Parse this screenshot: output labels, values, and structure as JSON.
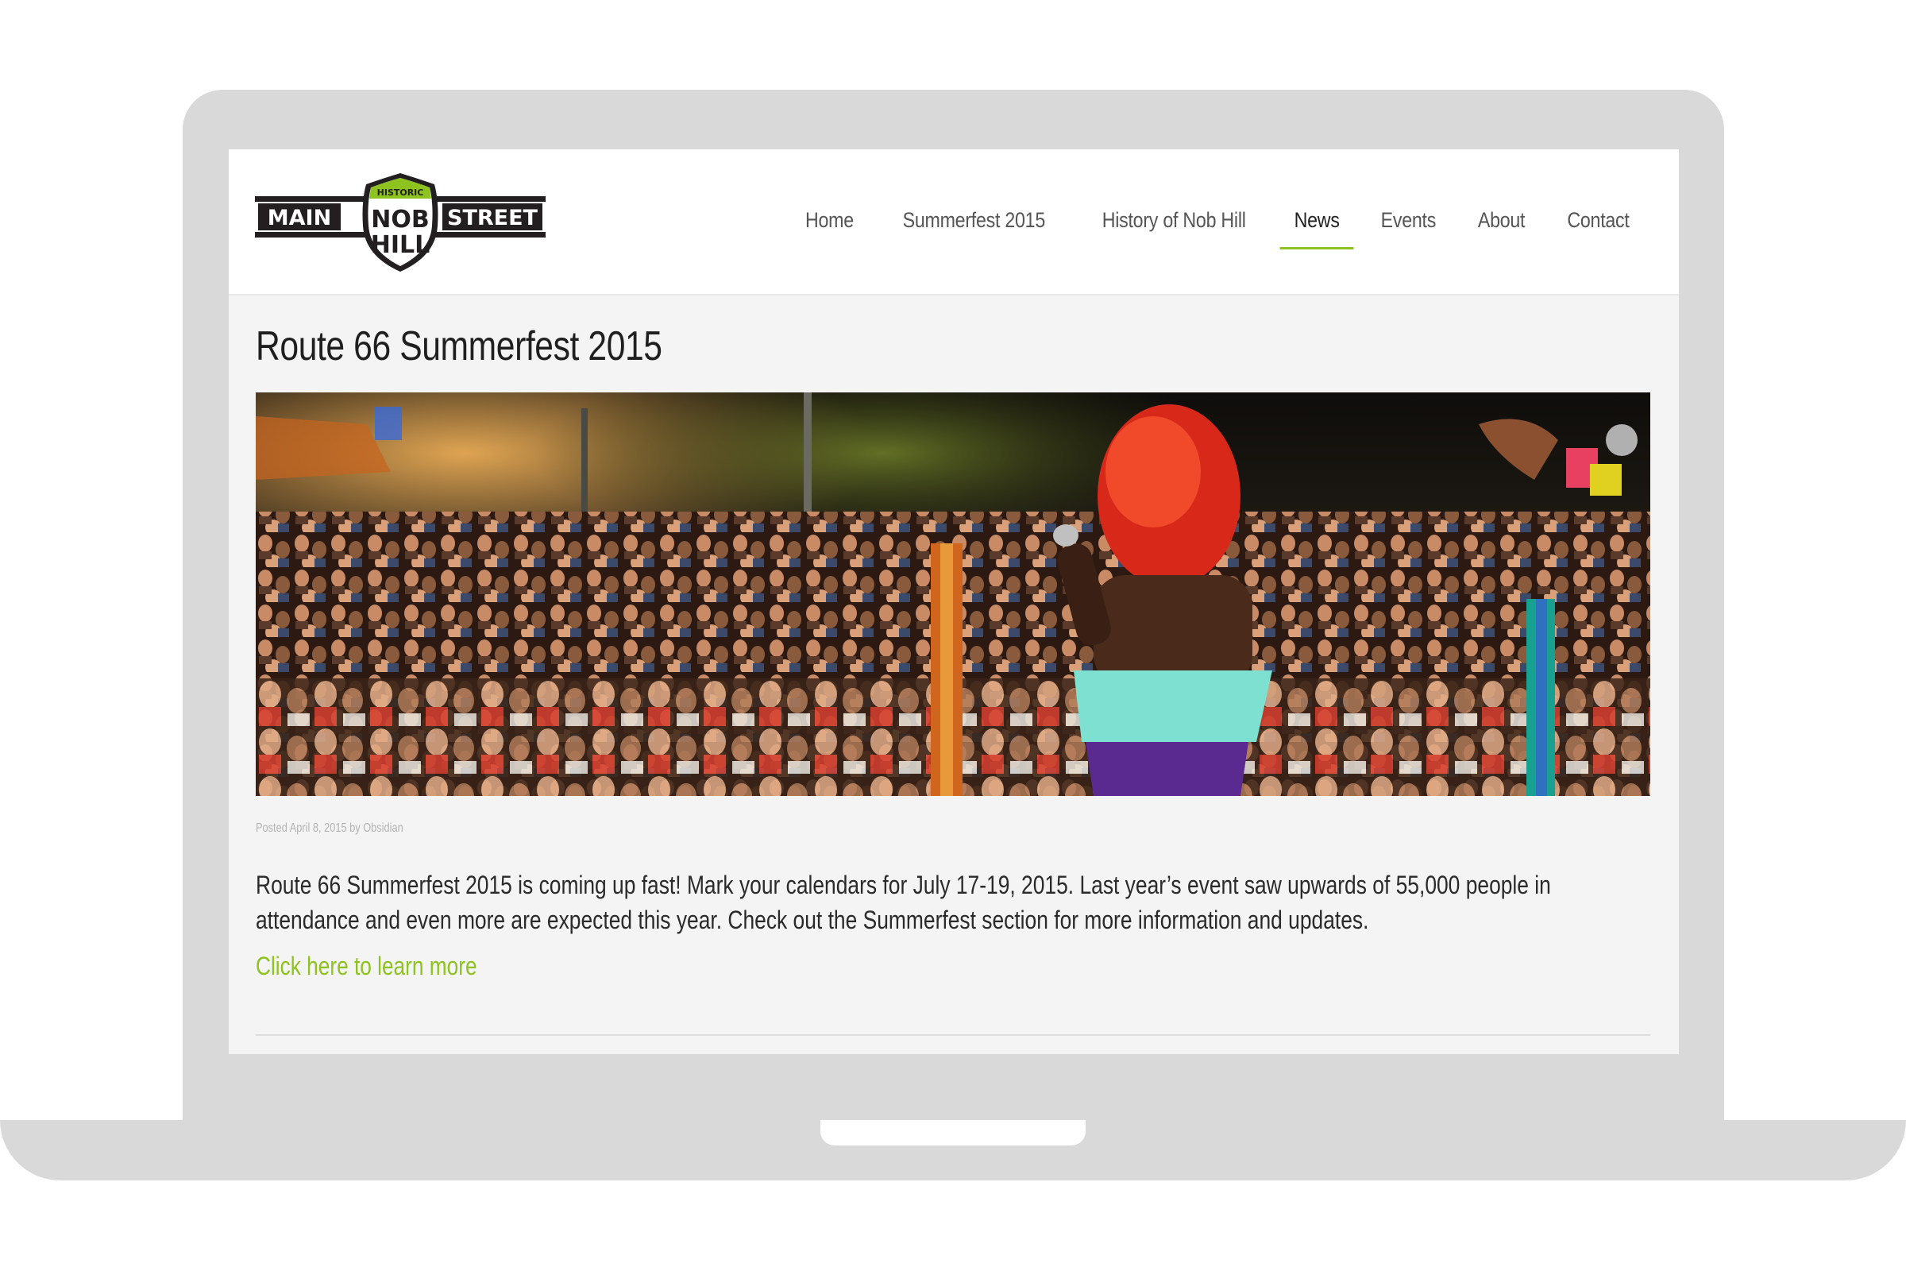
{
  "logo": {
    "left_text": "MAIN",
    "top_text": "HISTORIC",
    "center_line1": "NOB",
    "center_line2": "HILL",
    "right_text": "STREET"
  },
  "nav": {
    "items": [
      {
        "label": "Home",
        "active": false
      },
      {
        "label": "Summerfest 2015",
        "active": false
      },
      {
        "label": "History of Nob Hill",
        "active": false
      },
      {
        "label": "News",
        "active": true
      },
      {
        "label": "Events",
        "active": false
      },
      {
        "label": "About",
        "active": false
      },
      {
        "label": "Contact",
        "active": false
      }
    ]
  },
  "post": {
    "title": "Route 66 Summerfest 2015",
    "meta": "Posted April 8, 2015 by Obsidian",
    "body": "Route 66 Summerfest 2015 is coming up fast! Mark your calendars for July 17-19, 2015. Last year’s event saw upwards of 55,000 people in attendance and even more are expected this year. Check out the Summerfest section for more information and updates.",
    "link": "Click here to learn more"
  },
  "colors": {
    "accent": "#8dc21f",
    "device": "#d9d9d9",
    "screen_bg": "#f4f4f4"
  }
}
